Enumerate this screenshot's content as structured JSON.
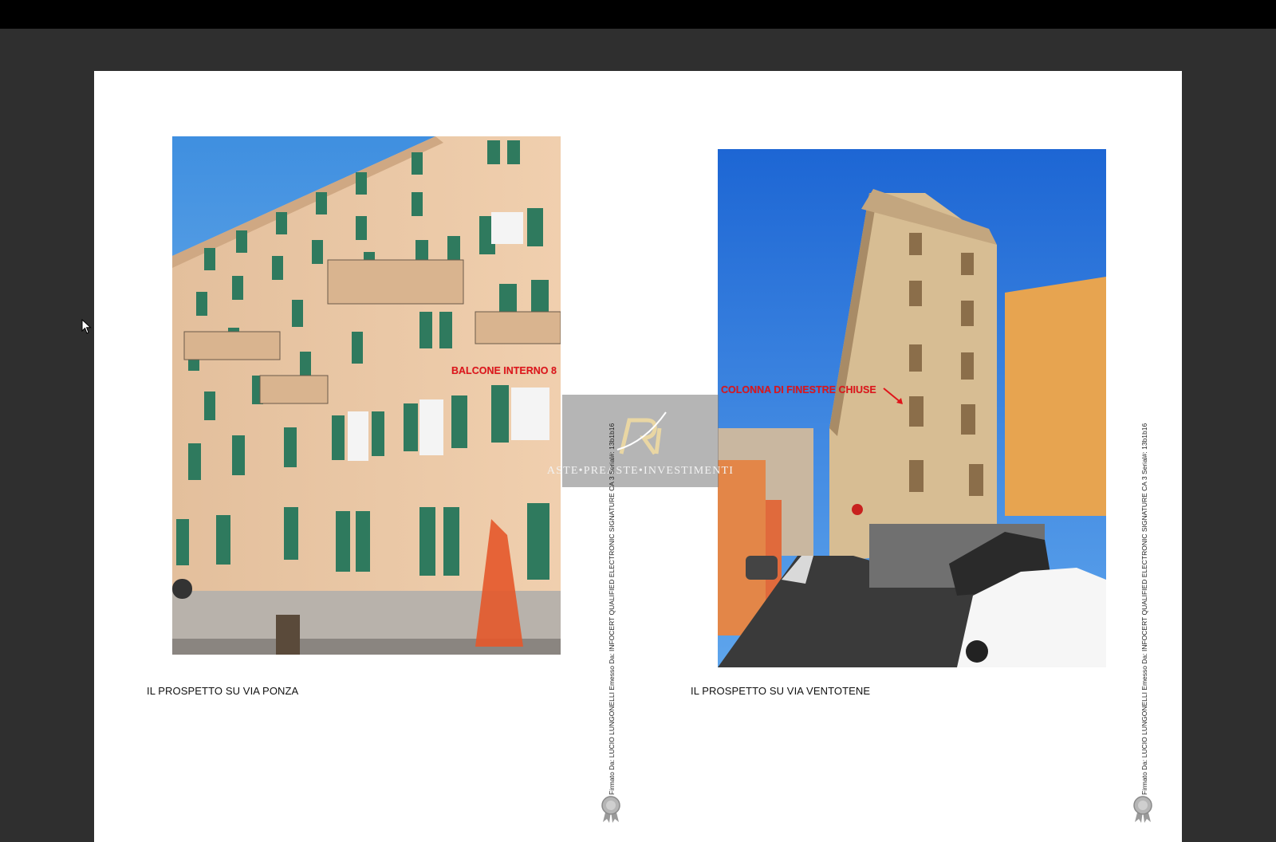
{
  "document": {
    "left_page": {
      "caption": "IL PROSPETTO SU VIA PONZA",
      "photo_label": "BALCONE INTERNO 8",
      "signature": "Firmato Da: LUCIO LUNGONELLI Emesso Da: INFOCERT QUALIFIED ELECTRONIC SIGNATURE CA 3 Serial#: 13b1b16"
    },
    "right_page": {
      "caption": "IL PROSPETTO SU VIA VENTOTENE",
      "photo_label": "COLONNA DI FINESTRE CHIUSE",
      "signature": "Firmato Da: LUCIO LUNGONELLI Emesso Da: INFOCERT QUALIFIED ELECTRONIC SIGNATURE CA 3 Serial#: 13b1b16"
    },
    "watermark": {
      "text": "ASTE•PREASTE•INVESTIMENTI"
    }
  },
  "icons": {
    "cursor": "mouse-pointer-icon",
    "seal": "certificate-seal-icon",
    "logo": "ri-logo-icon"
  },
  "colors": {
    "viewer_background": "#2f2f2f",
    "page_background": "#ffffff",
    "label_red": "#e0141a"
  }
}
